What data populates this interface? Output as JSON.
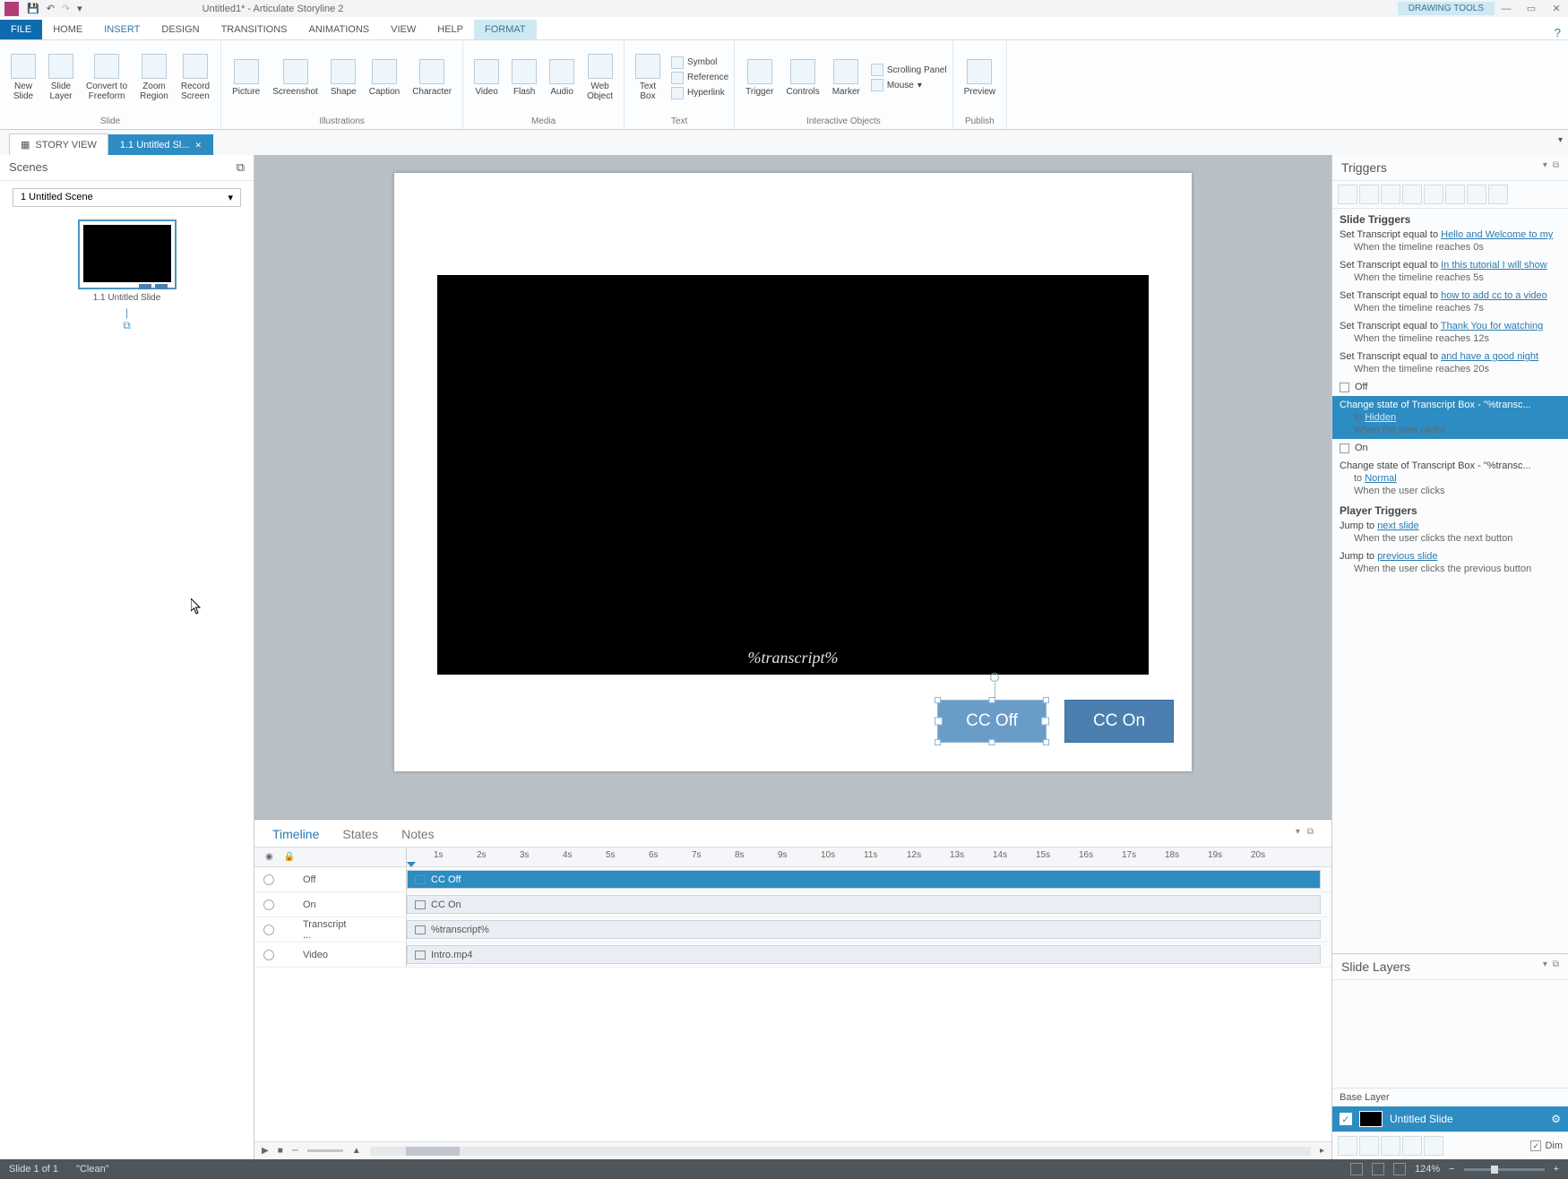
{
  "titlebar": {
    "title": "Untitled1* - Articulate Storyline 2",
    "context": "DRAWING TOOLS"
  },
  "tabs": {
    "file": "FILE",
    "home": "HOME",
    "insert": "INSERT",
    "design": "DESIGN",
    "transitions": "TRANSITIONS",
    "animations": "ANIMATIONS",
    "view": "VIEW",
    "help": "HELP",
    "format": "FORMAT"
  },
  "ribbon": {
    "slide": {
      "label": "Slide",
      "new_slide": "New\nSlide",
      "slide_layer": "Slide\nLayer",
      "convert": "Convert to\nFreeform",
      "zoom": "Zoom\nRegion",
      "record": "Record\nScreen"
    },
    "illustrations": {
      "label": "Illustrations",
      "picture": "Picture",
      "screenshot": "Screenshot",
      "shape": "Shape",
      "caption": "Caption",
      "character": "Character"
    },
    "media": {
      "label": "Media",
      "video": "Video",
      "flash": "Flash",
      "audio": "Audio",
      "web": "Web\nObject"
    },
    "text": {
      "label": "Text",
      "textbox": "Text\nBox",
      "symbol": "Symbol",
      "reference": "Reference",
      "hyperlink": "Hyperlink"
    },
    "interactive": {
      "label": "Interactive Objects",
      "trigger": "Trigger",
      "controls": "Controls",
      "marker": "Marker",
      "scrolling": "Scrolling Panel",
      "mouse": "Mouse"
    },
    "publish": {
      "label": "Publish",
      "preview": "Preview"
    }
  },
  "doctabs": {
    "story": "STORY VIEW",
    "slide": "1.1 Untitled Sl..."
  },
  "scenes": {
    "header": "Scenes",
    "dropdown": "1 Untitled Scene",
    "thumb_title": "1.1 Untitled Slide"
  },
  "canvas": {
    "transcript": "%transcript%",
    "cc_off": "CC Off",
    "cc_on": "CC On"
  },
  "timeline": {
    "tabs": {
      "timeline": "Timeline",
      "states": "States",
      "notes": "Notes"
    },
    "ticks": [
      "1s",
      "2s",
      "3s",
      "4s",
      "5s",
      "6s",
      "7s",
      "8s",
      "9s",
      "10s",
      "11s",
      "12s",
      "13s",
      "14s",
      "15s",
      "16s",
      "17s",
      "18s",
      "19s",
      "20s"
    ],
    "rows": [
      {
        "name": "Off",
        "obj": "CC Off"
      },
      {
        "name": "On",
        "obj": "CC On"
      },
      {
        "name": "Transcript ...",
        "obj": "%transcript%"
      },
      {
        "name": "Video",
        "obj": "Intro.mp4"
      }
    ]
  },
  "triggers": {
    "header": "Triggers",
    "slide_triggers": "Slide Triggers",
    "items": [
      {
        "pre": "Set Transcript equal to ",
        "link": "Hello and Welcome to my",
        "sub": "When the timeline reaches 0s"
      },
      {
        "pre": "Set Transcript equal to ",
        "link": "In this tutorial I will show ",
        "sub": "When the timeline reaches 5s"
      },
      {
        "pre": "Set Transcript equal to ",
        "link": "how to add cc to a video",
        "sub": "When the timeline reaches 7s"
      },
      {
        "pre": "Set Transcript equal to ",
        "link": "Thank You for watching",
        "sub": "When the timeline reaches 12s"
      },
      {
        "pre": "Set Transcript equal to ",
        "link": "and have a good night",
        "sub": "When the timeline reaches 20s"
      }
    ],
    "off_label": "Off",
    "off_trigger": {
      "line1": "Change state of Transcript Box - \"%transc...",
      "to": "to ",
      "link": "Hidden",
      "sub": "When the user clicks"
    },
    "on_label": "On",
    "on_trigger": {
      "line1": "Change state of Transcript Box - \"%transc...",
      "to": "to ",
      "link": "Normal",
      "sub": "When the user clicks"
    },
    "player_triggers": "Player Triggers",
    "player": [
      {
        "pre": "Jump to ",
        "link": "next slide",
        "sub": "When the user clicks the next button"
      },
      {
        "pre": "Jump to ",
        "link": "previous slide",
        "sub": "When the user clicks the previous button"
      }
    ]
  },
  "layers": {
    "header": "Slide Layers",
    "base": "Base Layer",
    "row": "Untitled Slide",
    "dim": "Dim"
  },
  "status": {
    "slide": "Slide 1 of 1",
    "clean": "\"Clean\"",
    "zoom": "124%"
  }
}
